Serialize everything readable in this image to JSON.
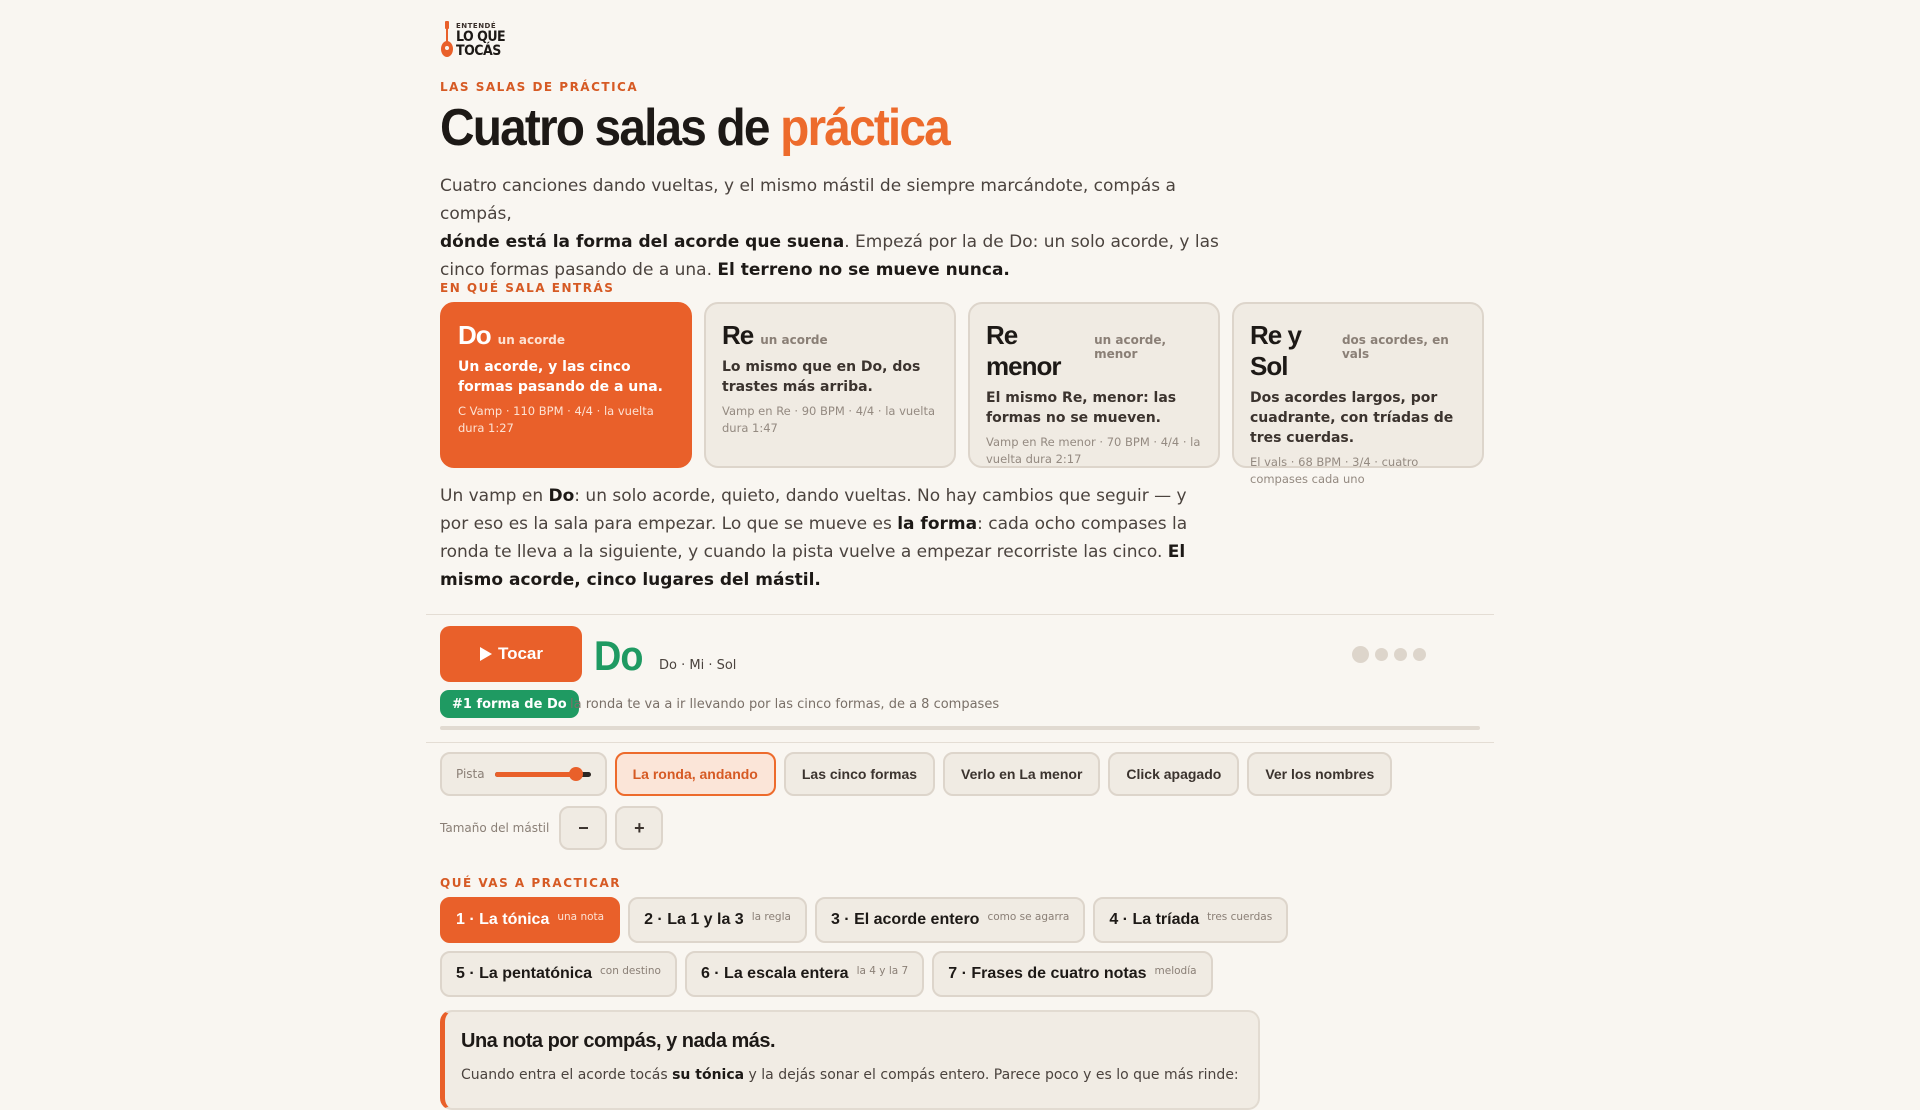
{
  "brand": {
    "logo_top": "ENTENDÉ",
    "logo_bottom": "LO QUE TOCÁS"
  },
  "colors": {
    "accent": "#e9602a",
    "green": "#1f9a62",
    "background": "#f9f6f1",
    "card": "#f0ebe3"
  },
  "header": {
    "eyebrow": "LAS SALAS DE PRÁCTICA",
    "title_main": "Cuatro salas de ",
    "title_accent": "práctica"
  },
  "intro": {
    "p1": "Cuatro canciones dando vueltas, y el mismo mástil de siempre marcándote, compás a compás,",
    "b1": "dónde está la forma del acorde que suena",
    "p2": ". Empezá por la de Do: un solo acorde, y las cinco formas pasando de a una. ",
    "b2": "El terreno no se mueve nunca."
  },
  "rooms_label": "EN QUÉ SALA ENTRÁS",
  "rooms": [
    {
      "name": "Do",
      "sub": "un acorde",
      "desc": "Un acorde, y las cinco formas pasando de a una.",
      "meta": "C Vamp · 110 BPM · 4/4 · la vuelta dura 1:27"
    },
    {
      "name": "Re",
      "sub": "un acorde",
      "desc": "Lo mismo que en Do, dos trastes más arriba.",
      "meta": "Vamp en Re · 90 BPM · 4/4 · la vuelta dura 1:47"
    },
    {
      "name": "Re menor",
      "sub": "un acorde, menor",
      "desc": "El mismo Re, menor: las formas no se mueven.",
      "meta": "Vamp en Re menor · 70 BPM · 4/4 · la vuelta dura 2:17"
    },
    {
      "name": "Re y Sol",
      "sub": "dos acordes, en vals",
      "desc": "Dos acordes largos, por cuadrante, con tríadas de tres cuerdas.",
      "meta": "El vals · 68 BPM · 3/4 · cuatro compases cada uno"
    }
  ],
  "room_desc": {
    "t1": "Un vamp en ",
    "b1": "Do",
    "t2": ": un solo acorde, quieto, dando vueltas. No hay cambios que seguir — y por eso es la sala para empezar. Lo que se mueve es ",
    "b2": "la forma",
    "t3": ": cada ocho compases la ronda te lleva a la siguiente, y cuando la pista vuelve a empezar recorriste las cinco. ",
    "b3": "El mismo acorde, cinco lugares del mástil."
  },
  "player": {
    "play_icon": "play-icon",
    "play_label": "Tocar",
    "chord": "Do",
    "notes": "Do · Mi · Sol",
    "shape_badge": "#1 forma de Do",
    "round_text": "la ronda te va a ir llevando por las cinco formas, de a 8 compases",
    "progress": 0
  },
  "controls": {
    "pista_label": "Pista",
    "pista_volume": 0.85,
    "buttons": [
      "La ronda, andando",
      "Las cinco formas",
      "Verlo en La menor",
      "Click apagado",
      "Ver los nombres"
    ],
    "size_label": "Tamaño del mástil",
    "minus": "−",
    "plus": "+"
  },
  "practice": {
    "label": "QUÉ VAS A PRACTICAR",
    "row1": [
      {
        "label": "1 · La tónica",
        "sub": "una nota"
      },
      {
        "label": "2 · La 1 y la 3",
        "sub": "la regla"
      },
      {
        "label": "3 · El acorde entero",
        "sub": "como se agarra"
      },
      {
        "label": "4 · La tríada",
        "sub": "tres cuerdas"
      }
    ],
    "row2": [
      {
        "label": "5 · La pentatónica",
        "sub": "con destino"
      },
      {
        "label": "6 · La escala entera",
        "sub": "la 4 y la 7"
      },
      {
        "label": "7 · Frases de cuatro notas",
        "sub": "melodía"
      }
    ]
  },
  "lesson": {
    "title": "Una nota por compás, y nada más.",
    "t1": "Cuando entra el acorde tocás ",
    "b1": "su tónica",
    "t2": " y la dejás sonar el compás entero. Parece poco y es lo que más rinde:"
  }
}
